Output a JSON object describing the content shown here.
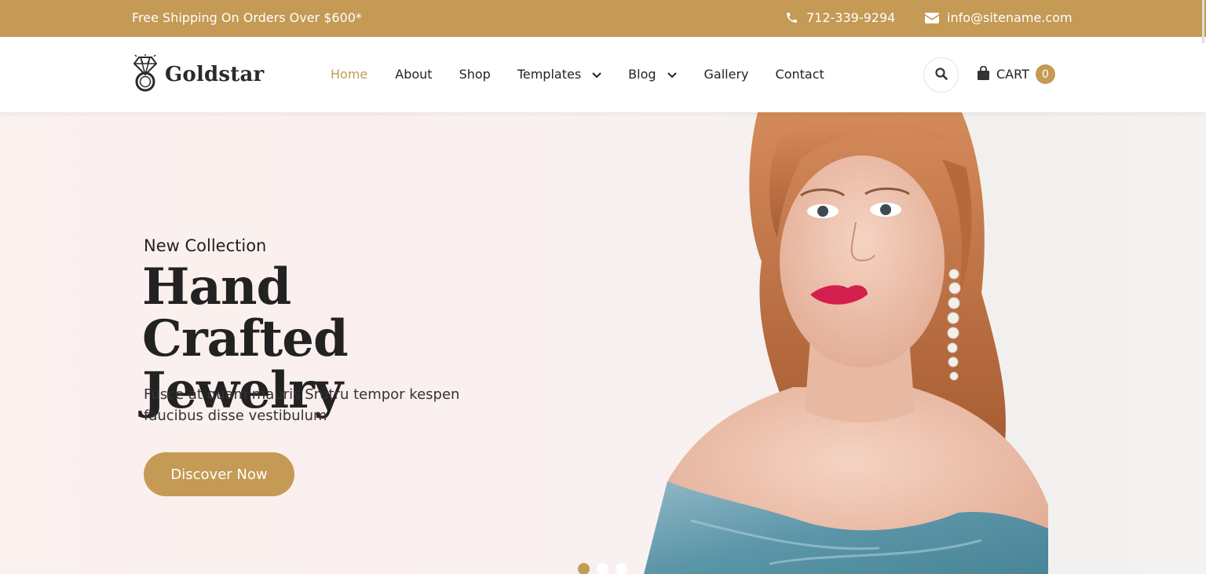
{
  "topbar": {
    "shipping_text": "Free Shipping On Orders Over $600*",
    "phone": "712-339-9294",
    "email": "info@sitename.com",
    "phone_icon": "phone-icon",
    "email_icon": "envelope-icon"
  },
  "header": {
    "logo_text": "Goldstar",
    "logo_icon": "diamond-ring-icon",
    "nav": [
      {
        "label": "Home",
        "active": true
      },
      {
        "label": "About"
      },
      {
        "label": "Shop"
      },
      {
        "label": "Templates",
        "dropdown": true
      },
      {
        "label": "Blog",
        "dropdown": true
      },
      {
        "label": "Gallery"
      },
      {
        "label": "Contact"
      }
    ],
    "cart_label": "CART",
    "cart_count": "0"
  },
  "hero": {
    "subtitle": "New Collection",
    "title": "Hand Crafted Jewelry",
    "description": "Fusce at quam mauris Srutru tempor kespen faucibus disse vestibulum",
    "cta_label": "Discover Now",
    "slide_count": 3,
    "active_slide": 1
  },
  "colors": {
    "accent": "#c49a54",
    "text_dark": "#222222"
  }
}
